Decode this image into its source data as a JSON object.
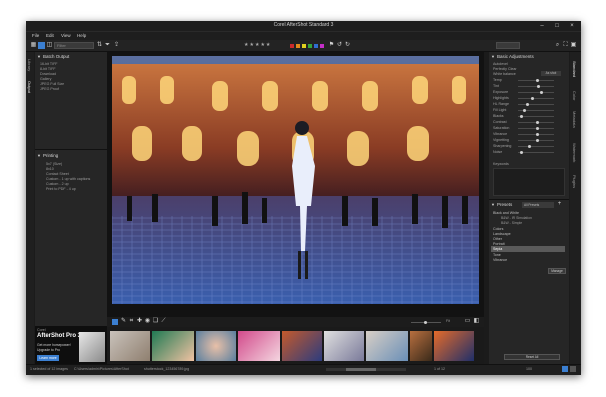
{
  "window": {
    "title": "Corel AfterShot Standard 3"
  },
  "menu": [
    "File",
    "Edit",
    "View",
    "Help"
  ],
  "toolbar": {
    "filter_placeholder": "Filter",
    "stars": "★★★★★"
  },
  "left": {
    "batch_title": "Batch Output",
    "batch_items": [
      "16-bit TIFF",
      "8-bit TIFF",
      "Download",
      "Gallery",
      "JPEG Full Size",
      "JPEG Proof"
    ],
    "printing_title": "Printing",
    "printing_items": [
      "5x7 (Size)",
      "8x10",
      "Contact Sheet",
      "Custom - 1 up with captions",
      "Custom - 2 up",
      "Print to PDF - 4 up"
    ],
    "tabs": [
      "Library",
      "Output"
    ]
  },
  "ad": {
    "brand": "Corel",
    "product": "AfterShot Pro 3",
    "line1": "Get more horsepower!",
    "line2": "Upgrade to Pro",
    "cta": "Learn more"
  },
  "right": {
    "basic_title": "Basic Adjustments",
    "rows": [
      "Autolevel",
      "Perfectly Clear",
      "White balance",
      "Temp",
      "Tint",
      "Exposure",
      "Highlights",
      "HL Range",
      "Fill Light",
      "Blacks",
      "Contrast",
      "Saturation",
      "Vibrance",
      "Vignetting",
      "Sharpening",
      "Noise"
    ],
    "wb_value": "As shot",
    "keywords_label": "Keywords",
    "presets_title": "Presets",
    "presets_dropdown": "All Presets",
    "preset_items": [
      "Black and White",
      "B&W - IR Simulation",
      "B&W - Simple",
      "Colors",
      "Landscape",
      "Other",
      "Portrait",
      "Sepia",
      "Tone",
      "Vibrance"
    ],
    "manage_label": "Manage",
    "reset_label": "Reset All",
    "vtabs": [
      "Standard",
      "Color",
      "Metadata",
      "Watermark",
      "Plugins"
    ]
  },
  "filmstrip": {
    "zoom": "Fit"
  },
  "status": {
    "selection": "1 selected of 12 images",
    "path": "C:\\Users\\admin\\Pictures\\AfterShot",
    "file": "shutterstock_123456789.jpg",
    "counter": "1 of 12",
    "zoom": "100"
  },
  "colors": {
    "bg": "#1b1b1b",
    "panel": "#262626",
    "accent": "#3b7fd1"
  }
}
